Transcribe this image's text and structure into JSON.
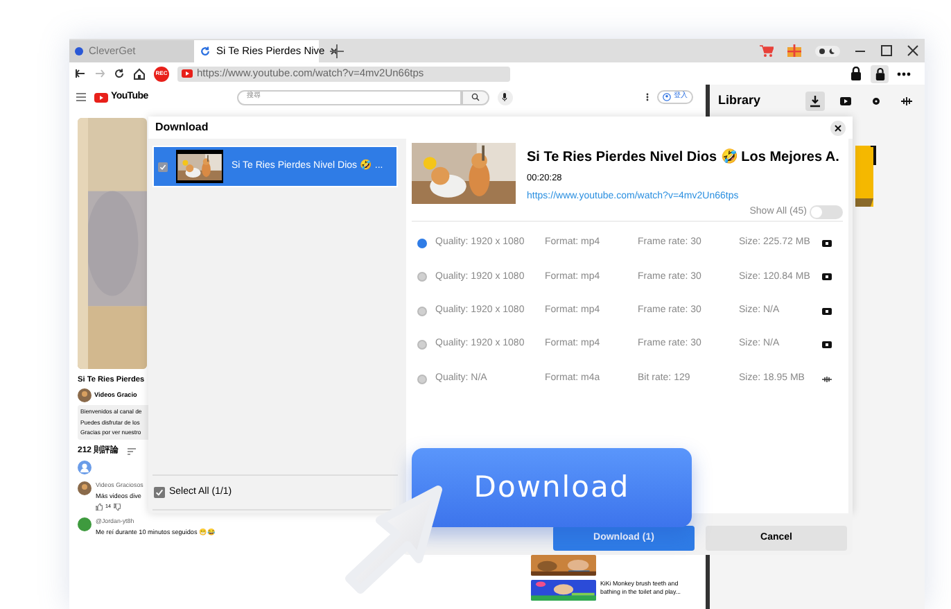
{
  "browser": {
    "tabs": [
      {
        "label": "CleverGet",
        "selected": false
      },
      {
        "label": "Si Te Ries Pierdes Nive",
        "selected": true
      }
    ],
    "rec_label": "REC",
    "url": "https://www.youtube.com/watch?v=4mv2Un66tps"
  },
  "youtube": {
    "logo": "YouTube",
    "search_placeholder": "搜尋",
    "sign_in": "登入",
    "video_title": "Si Te Ries Pierdes",
    "channel": "Videos Gracio",
    "description": [
      "Bienvenidos al canal de",
      "Puedes disfrutar de los",
      "Gracias por ver nuestro"
    ],
    "comments_count": "212 則評論",
    "comments": [
      {
        "author": "Videos Graciosos",
        "text": "Más videos dive",
        "likes": "14"
      },
      {
        "author": "@Jordan-yt8h",
        "text": "Me reí durante 10 minutos seguidos 😁😂"
      }
    ],
    "related": [
      {
        "kind": "picture"
      },
      {
        "kind": "video",
        "title": "KiKi Monkey brush teeth and bathing in the toilet and play..."
      }
    ]
  },
  "library": {
    "title": "Library",
    "tabs": [
      {
        "kind": "download",
        "selected": true
      },
      {
        "kind": "video",
        "selected": false
      },
      {
        "kind": "dot",
        "selected": false
      },
      {
        "kind": "audio",
        "selected": false
      }
    ]
  },
  "dialog": {
    "title": "Download",
    "items": [
      {
        "title": "Si Te Ries Pierdes Nivel Dios 🤣 ...",
        "checked": true,
        "selected": true
      }
    ],
    "video": {
      "title": "Si Te Ries Pierdes Nivel Dios 🤣 Los Mejores A.",
      "duration": "00:20:28",
      "url": "https://www.youtube.com/watch?v=4mv2Un66tps"
    },
    "show_all": {
      "label": "Show All (45)",
      "on": false
    },
    "formats": [
      {
        "kind": "video",
        "quality": "Quality: 1920 x 1080",
        "format": "Format: mp4",
        "rate": "Frame rate: 30",
        "size": "Size: 225.72 MB",
        "selected": true
      },
      {
        "kind": "video",
        "quality": "Quality: 1920 x 1080",
        "format": "Format: mp4",
        "rate": "Frame rate: 30",
        "size": "Size: 120.84 MB",
        "selected": false
      },
      {
        "kind": "video",
        "quality": "Quality: 1920 x 1080",
        "format": "Format: mp4",
        "rate": "Frame rate: 30",
        "size": "Size: N/A",
        "selected": false
      },
      {
        "kind": "video",
        "quality": "Quality: 1920 x 1080",
        "format": "Format: mp4",
        "rate": "Frame rate: 30",
        "size": "Size: N/A",
        "selected": false
      },
      {
        "kind": "audio",
        "quality": "Quality: N/A",
        "format": "Format: m4a",
        "rate": "Bit rate: 129",
        "size": "Size: 18.95 MB",
        "selected": false
      }
    ],
    "select_all": {
      "label": "Select All (1/1)",
      "checked": true
    },
    "buttons": [
      {
        "kind": "primary",
        "label": "Download (1)"
      },
      {
        "kind": "secondary",
        "label": "Cancel"
      }
    ]
  },
  "promo_button": "Download"
}
